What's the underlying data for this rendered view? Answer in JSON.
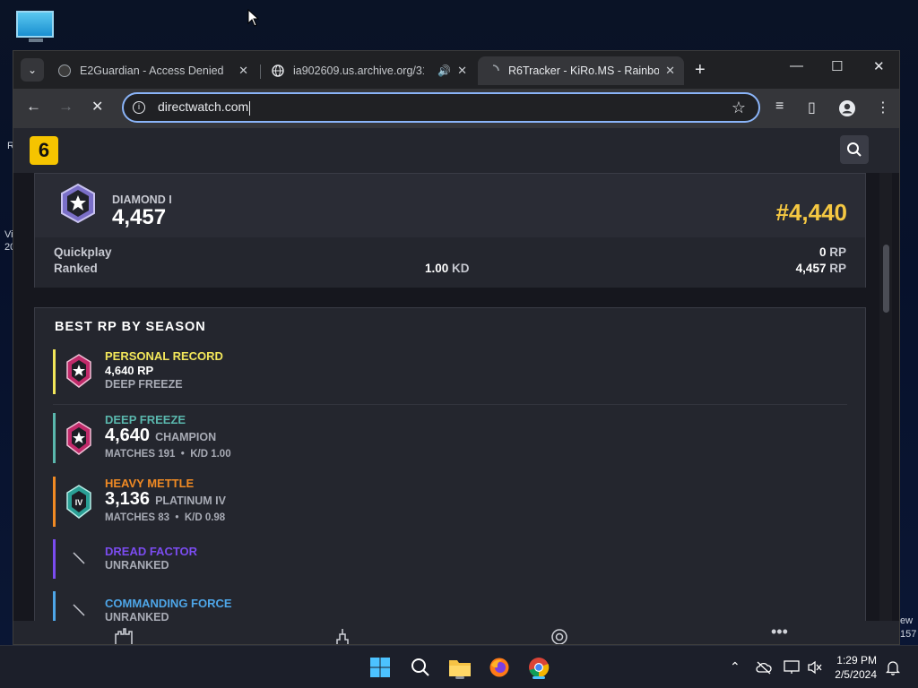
{
  "desktop": {
    "left_fragments": [
      "R",
      "Vi",
      "20"
    ],
    "right_fragments": [
      "ew",
      "157"
    ]
  },
  "browser": {
    "tabs": [
      {
        "title": "E2Guardian - Access Denied",
        "active": false
      },
      {
        "title": "ia902609.us.archive.org/31/",
        "active": false,
        "audio": true
      },
      {
        "title": "R6Tracker - KiRo.MS - Rainbow",
        "active": true,
        "loading": true
      }
    ],
    "address": "directwatch.com",
    "window_controls": {
      "minimize": "—",
      "maximize": "☐",
      "close": "✕"
    }
  },
  "site": {
    "logo": "6",
    "rank": {
      "tier": "DIAMOND I",
      "rp": "4,457",
      "position": "#4,440",
      "rows": [
        {
          "label": "Quickplay",
          "kd": "",
          "rp": "0",
          "unit": "RP"
        },
        {
          "label": "Ranked",
          "kd": "1.00",
          "kd_unit": "KD",
          "rp": "4,457",
          "unit": "RP"
        }
      ]
    },
    "best": {
      "title": "BEST RP BY SEASON",
      "personal": {
        "label": "PERSONAL RECORD",
        "rp": "4,640 RP",
        "season": "DEEP FREEZE"
      },
      "seasons": [
        {
          "name": "DEEP FREEZE",
          "rp": "4,640",
          "tier": "CHAMPION",
          "matches": "MATCHES 191",
          "kd": "K/D 1.00"
        },
        {
          "name": "HEAVY METTLE",
          "rp": "3,136",
          "tier": "PLATINUM IV",
          "matches": "MATCHES 83",
          "kd": "K/D 0.98"
        },
        {
          "name": "DREAD FACTOR",
          "status": "UNRANKED"
        },
        {
          "name": "COMMANDING FORCE",
          "status": "UNRANKED"
        }
      ]
    },
    "bottom_nav": [
      "castle-icon",
      "trophy-icon",
      "operator-icon",
      "more-icon"
    ]
  },
  "taskbar": {
    "time": "1:29 PM",
    "date": "2/5/2024"
  },
  "colors": {
    "accent_yellow": "#f5c842",
    "personal": "#f2e65a",
    "deep_freeze": "#5ab7ad",
    "heavy_mettle": "#f08a24",
    "dread_factor": "#7b4cf0",
    "commanding_force": "#4ea6e8"
  }
}
